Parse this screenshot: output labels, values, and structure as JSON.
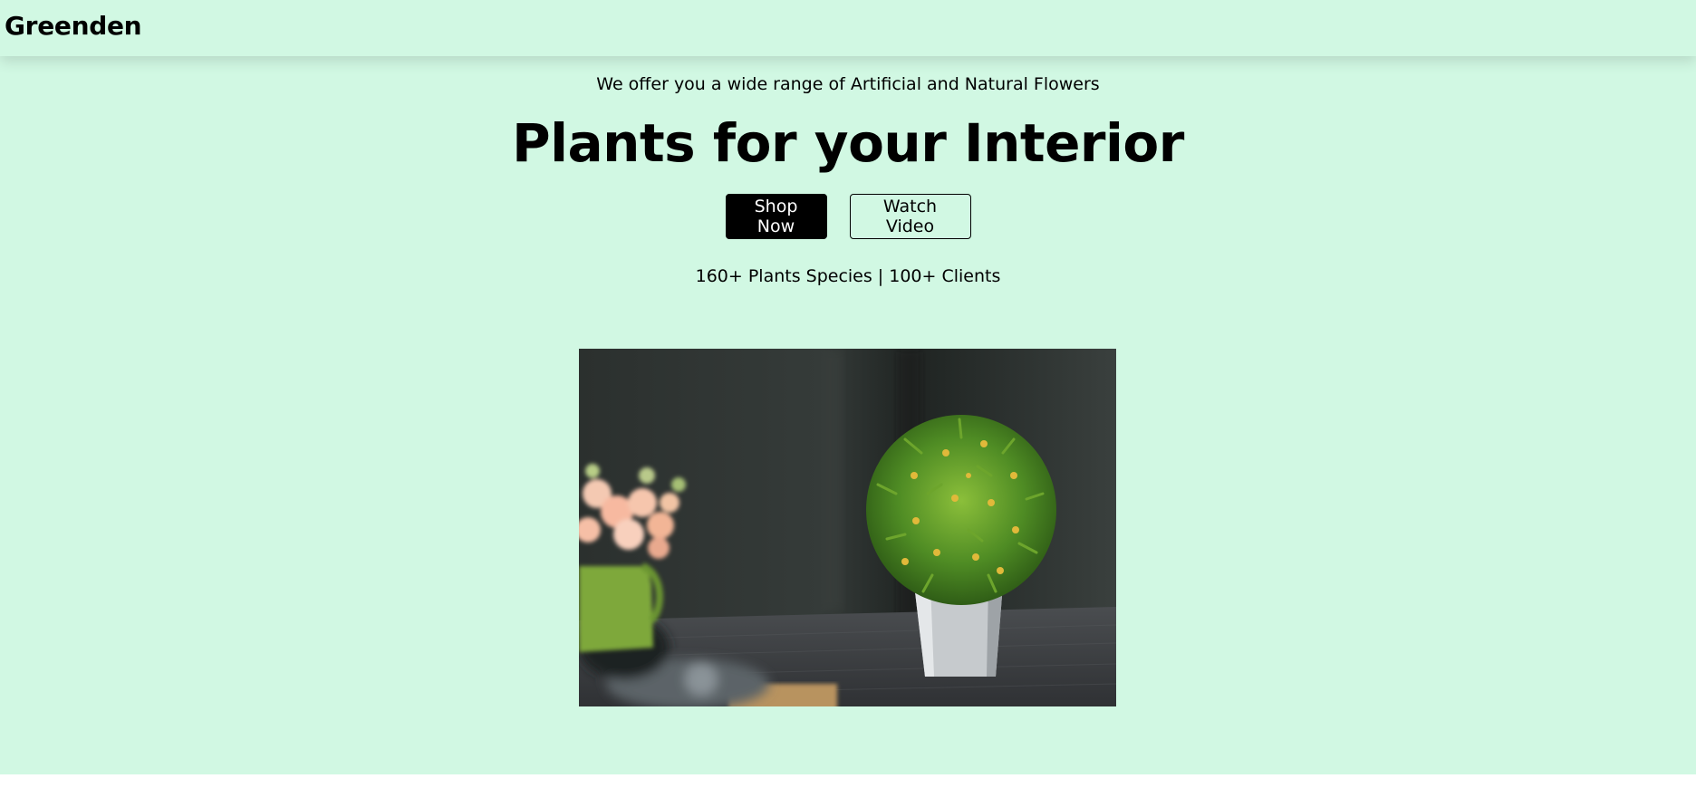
{
  "navbar": {
    "brand": "Greenden"
  },
  "hero": {
    "tagline": "We offer you a wide range of Artificial and Natural Flowers",
    "headline": "Plants for your Interior",
    "shop_now_label": "Shop Now",
    "watch_video_label": "Watch Video",
    "stats": "160+ Plants Species | 100+ Clients",
    "image": "potted-plant-photo"
  },
  "colors": {
    "background": "#d1f8e3",
    "primary_button": "#000000",
    "text": "#000000"
  }
}
